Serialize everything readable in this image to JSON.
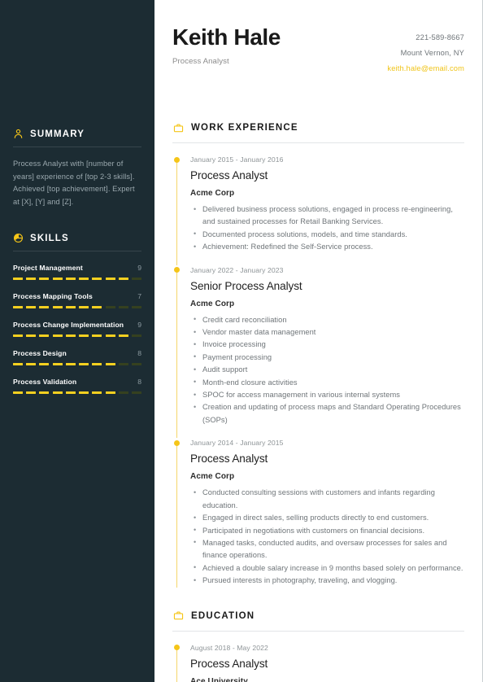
{
  "theme": {
    "sidebar_bg": "#1c2c33",
    "accent": "#f5c518",
    "accent_dim": "#35411f",
    "text_muted": "#6f7579"
  },
  "header": {
    "name": "Keith Hale",
    "role": "Process Analyst",
    "contact": {
      "phone": "221-589-8667",
      "location": "Mount Vernon, NY",
      "email": "keith.hale@email.com"
    }
  },
  "sidebar": {
    "summary": {
      "icon": "user-icon",
      "title": "SUMMARY",
      "text": "Process Analyst with [number of years] experience of [top 2-3 skills]. Achieved [top achievement]. Expert at [X], [Y] and [Z]."
    },
    "skills": {
      "icon": "pie-chart-icon",
      "title": "SKILLS",
      "scale_max": 10,
      "items": [
        {
          "name": "Project Management",
          "value": 9
        },
        {
          "name": "Process Mapping Tools",
          "value": 7
        },
        {
          "name": "Process Change Implementation",
          "value": 9
        },
        {
          "name": "Process Design",
          "value": 8
        },
        {
          "name": "Process Validation",
          "value": 8
        }
      ]
    }
  },
  "work": {
    "icon": "briefcase-icon",
    "title": "WORK EXPERIENCE",
    "entries": [
      {
        "dates": "January 2015 - January 2016",
        "job_title": "Process Analyst",
        "company": "Acme Corp",
        "bullets": [
          "Delivered business process solutions, engaged in process re-engineering, and sustained processes for Retail Banking Services.",
          "Documented process solutions, models, and time standards.",
          "Achievement: Redefined the Self-Service process."
        ]
      },
      {
        "dates": "January 2022 - January 2023",
        "job_title": "Senior Process Analyst",
        "company": "Acme Corp",
        "bullets": [
          "Credit card reconciliation",
          "Vendor master data management",
          "Invoice processing",
          "Payment processing",
          "Audit support",
          "Month-end closure activities",
          "SPOC for access management in various internal systems",
          "Creation and updating of process maps and Standard Operating Procedures (SOPs)"
        ]
      },
      {
        "dates": "January 2014 - January 2015",
        "job_title": "Process Analyst",
        "company": "Acme Corp",
        "bullets": [
          "Conducted consulting sessions with customers and infants regarding education.",
          "Engaged in direct sales, selling products directly to end customers.",
          "Participated in negotiations with customers on financial decisions.",
          "Managed tasks, conducted audits, and oversaw processes for sales and finance operations.",
          "Achieved a double salary increase in 9 months based solely on performance.",
          "Pursued interests in photography, traveling, and vlogging."
        ]
      }
    ]
  },
  "education": {
    "icon": "briefcase-icon",
    "title": "EDUCATION",
    "entries": [
      {
        "dates": "August 2018 - May 2022",
        "job_title": "Process Analyst",
        "company": "Ace University"
      }
    ]
  }
}
